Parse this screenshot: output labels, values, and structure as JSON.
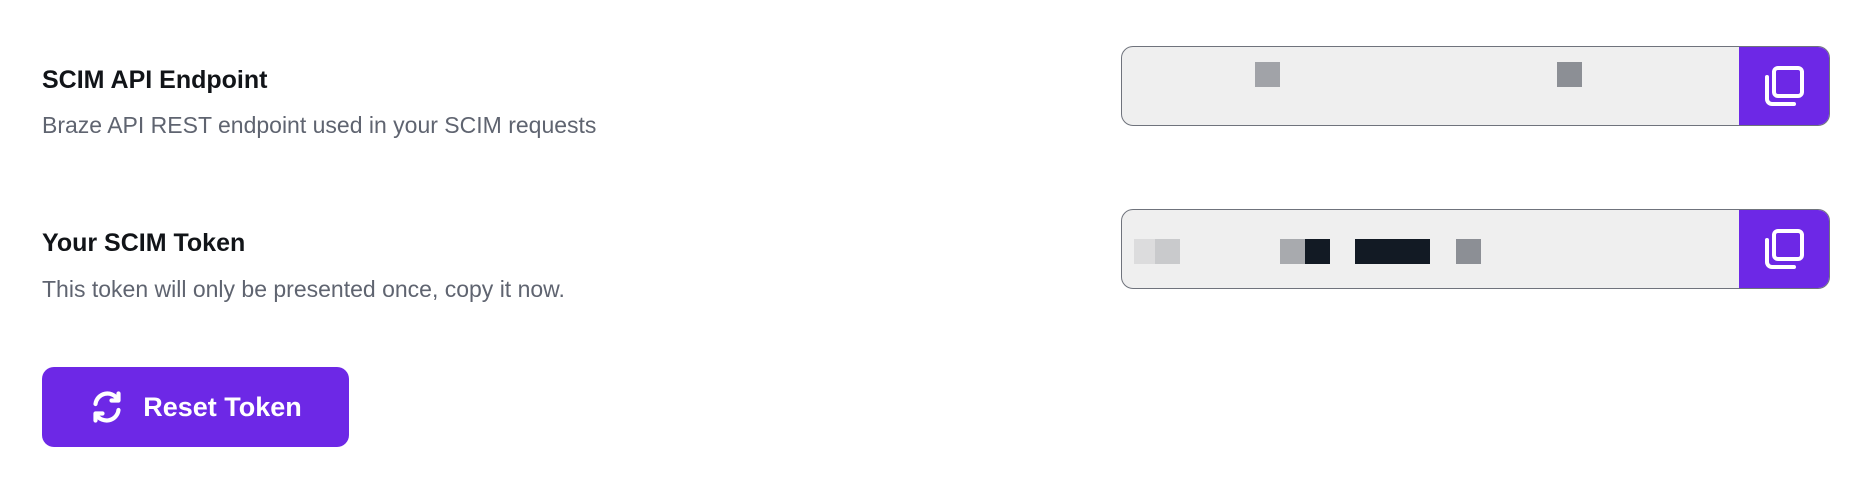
{
  "endpoint": {
    "label": "SCIM API Endpoint",
    "description": "Braze API REST endpoint used in your SCIM requests",
    "value": "",
    "copy_icon": "copy-icon"
  },
  "token": {
    "label": "Your SCIM Token",
    "description": "This token will only be presented once, copy it now.",
    "value": "",
    "copy_icon": "copy-icon"
  },
  "reset_button": {
    "label": "Reset Token",
    "icon": "refresh-icon"
  },
  "colors": {
    "accent": "#6d28e6",
    "field_background": "#efefef",
    "field_border": "#6f737c",
    "label_text": "#111418",
    "description_text": "#5f6470"
  }
}
